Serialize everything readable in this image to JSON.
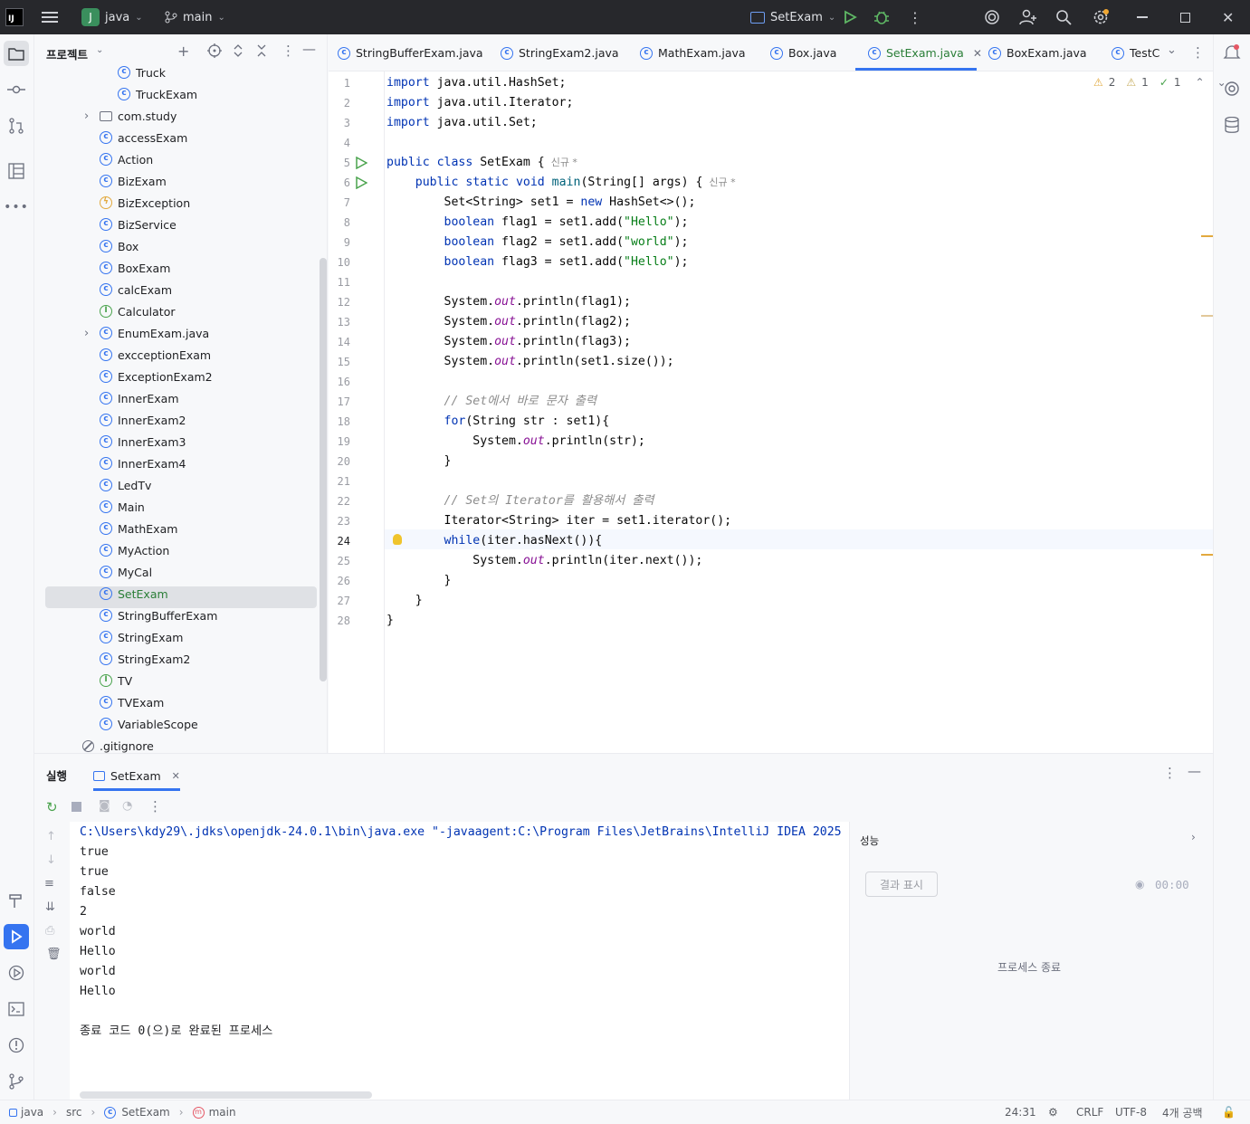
{
  "titlebar": {
    "project_badge": "J",
    "project": "java",
    "branch": "main",
    "run_config": "SetExam"
  },
  "project_panel": {
    "title": "프로젝트",
    "items": [
      {
        "label": "Truck",
        "icon": "class-icon"
      },
      {
        "label": "TruckExam",
        "icon": "class-icon"
      },
      {
        "label": "com.study",
        "icon": "folder-icon"
      },
      {
        "label": "accessExam",
        "icon": "class-icon"
      },
      {
        "label": "Action",
        "icon": "class-icon"
      },
      {
        "label": "BizExam",
        "icon": "class-icon"
      },
      {
        "label": "BizException",
        "icon": "exception-icon"
      },
      {
        "label": "BizService",
        "icon": "class-icon"
      },
      {
        "label": "Box",
        "icon": "class-icon"
      },
      {
        "label": "BoxExam",
        "icon": "class-icon"
      },
      {
        "label": "calcExam",
        "icon": "class-icon"
      },
      {
        "label": "Calculator",
        "icon": "interface-icon"
      },
      {
        "label": "EnumExam.java",
        "icon": "class-icon"
      },
      {
        "label": "excceptionExam",
        "icon": "class-icon"
      },
      {
        "label": "ExceptionExam2",
        "icon": "class-icon"
      },
      {
        "label": "InnerExam",
        "icon": "class-icon"
      },
      {
        "label": "InnerExam2",
        "icon": "class-icon"
      },
      {
        "label": "InnerExam3",
        "icon": "class-icon"
      },
      {
        "label": "InnerExam4",
        "icon": "class-icon"
      },
      {
        "label": "LedTv",
        "icon": "class-icon"
      },
      {
        "label": "Main",
        "icon": "class-icon"
      },
      {
        "label": "MathExam",
        "icon": "class-icon"
      },
      {
        "label": "MyAction",
        "icon": "class-icon"
      },
      {
        "label": "MyCal",
        "icon": "class-icon"
      },
      {
        "label": "SetExam",
        "icon": "class-icon",
        "selected": true
      },
      {
        "label": "StringBufferExam",
        "icon": "class-icon"
      },
      {
        "label": "StringExam",
        "icon": "class-icon"
      },
      {
        "label": "StringExam2",
        "icon": "class-icon"
      },
      {
        "label": "TV",
        "icon": "interface-icon"
      },
      {
        "label": "TVExam",
        "icon": "class-icon"
      },
      {
        "label": "VariableScope",
        "icon": "class-icon"
      },
      {
        "label": ".gitignore",
        "icon": "ignore-icon"
      }
    ]
  },
  "editor_tabs": [
    {
      "label": "StringBufferExam.java"
    },
    {
      "label": "StringExam2.java"
    },
    {
      "label": "MathExam.java"
    },
    {
      "label": "Box.java"
    },
    {
      "label": "SetExam.java",
      "active": true
    },
    {
      "label": "BoxExam.java"
    },
    {
      "label": "TestC"
    }
  ],
  "inspections": {
    "warnings": "2",
    "weak_warnings": "1",
    "ok": "1"
  },
  "code_hint": "신규 *",
  "code_lines": [
    "import java.util.HashSet;",
    "import java.util.Iterator;",
    "import java.util.Set;",
    "",
    "public class SetExam {",
    "    public static void main(String[] args) {",
    "        Set<String> set1 = new HashSet<>();",
    "        boolean flag1 = set1.add(\"Hello\");",
    "        boolean flag2 = set1.add(\"world\");",
    "        boolean flag3 = set1.add(\"Hello\");",
    "",
    "        System.out.println(flag1);",
    "        System.out.println(flag2);",
    "        System.out.println(flag3);",
    "        System.out.println(set1.size());",
    "",
    "        // Set에서 바로 문자 출력",
    "        for(String str : set1){",
    "            System.out.println(str);",
    "        }",
    "",
    "        // Set의 Iterator를 활용해서 출력",
    "        Iterator<String> iter = set1.iterator();",
    "        while(iter.hasNext()){",
    "            System.out.println(iter.next());",
    "        }",
    "    }",
    "}"
  ],
  "run_panel": {
    "title": "실행",
    "tab": "SetExam",
    "output": [
      "C:\\Users\\kdy29\\.jdks\\openjdk-24.0.1\\bin\\java.exe \"-javaagent:C:\\Program Files\\JetBrains\\IntelliJ IDEA 2025",
      "true",
      "true",
      "false",
      "2",
      "world",
      "Hello",
      "world",
      "Hello",
      "",
      "종료 코드 0(으)로 완료된 프로세스"
    ],
    "perf_title": "성능",
    "show_results": "결과 표시",
    "timer": "00:00",
    "process_ended": "프로세스 종료"
  },
  "statusbar": {
    "crumbs": [
      "java",
      "src",
      "SetExam",
      "main"
    ],
    "position": "24:31",
    "line_sep": "CRLF",
    "encoding": "UTF-8",
    "indent": "4개 공백"
  }
}
